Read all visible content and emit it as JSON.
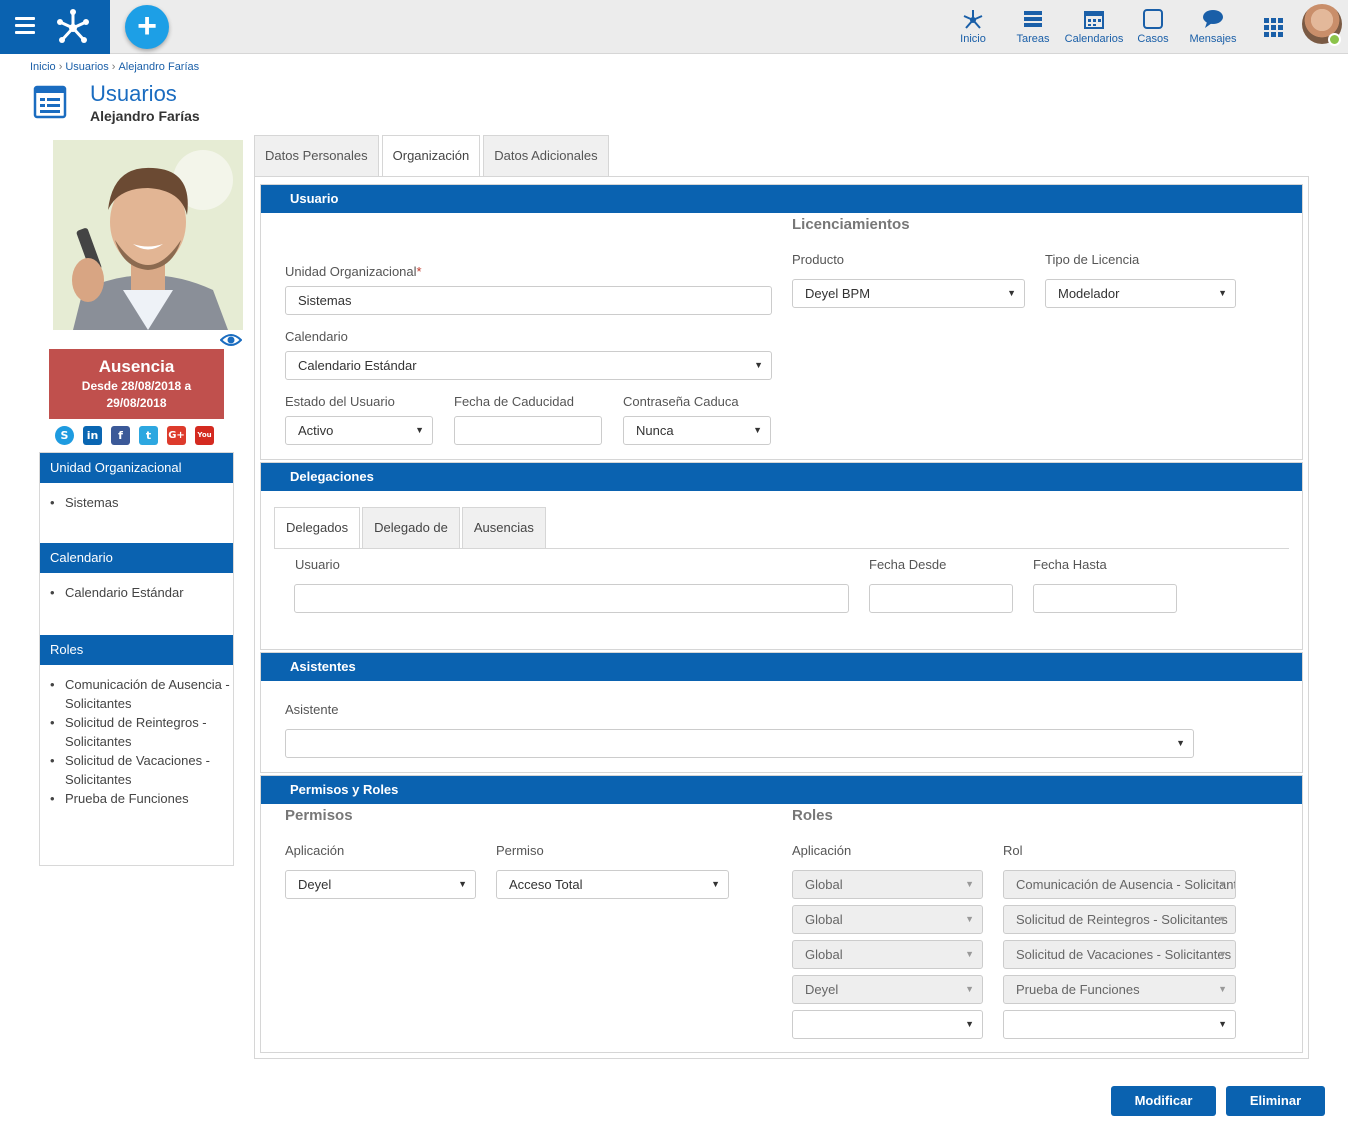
{
  "topbar": {
    "nav": [
      {
        "label": "Inicio",
        "icon": "network-icon"
      },
      {
        "label": "Tareas",
        "icon": "tasks-icon"
      },
      {
        "label": "Calendarios",
        "icon": "calendar-icon"
      },
      {
        "label": "Casos",
        "icon": "case-square-icon"
      },
      {
        "label": "Mensajes",
        "icon": "message-bubble-icon"
      }
    ],
    "brand_color": "#0a62b0",
    "add_color": "#1d9fe6"
  },
  "breadcrumb": [
    "Inicio",
    "Usuarios",
    "Alejandro Farías"
  ],
  "header": {
    "title": "Usuarios",
    "subtitle": "Alejandro Farías"
  },
  "profile": {
    "absence_title": "Ausencia",
    "absence_dates": "Desde 28/08/2018 a 29/08/2018",
    "absence_color": "#c0504d",
    "socials": [
      {
        "name": "skype-icon",
        "glyph": "S",
        "color": "#1e9be0"
      },
      {
        "name": "linkedin-icon",
        "glyph": "in",
        "color": "#0a66b2"
      },
      {
        "name": "facebook-icon",
        "glyph": "f",
        "color": "#3b5998"
      },
      {
        "name": "twitter-icon",
        "glyph": "t",
        "color": "#2da7e0"
      },
      {
        "name": "google-plus-icon",
        "glyph": "G+",
        "color": "#dd3b2c"
      },
      {
        "name": "youtube-icon",
        "glyph": "You",
        "color": "#d42a20"
      }
    ]
  },
  "sidebar": {
    "org_head": "Unidad Organizacional",
    "org_items": [
      "Sistemas"
    ],
    "cal_head": "Calendario",
    "cal_items": [
      "Calendario Estándar"
    ],
    "roles_head": "Roles",
    "roles_items": [
      "Comunicación de Ausencia - Solicitantes",
      "Solicitud de Reintegros - Solicitantes",
      "Solicitud de Vacaciones - Solicitantes",
      "Prueba de Funciones"
    ]
  },
  "tabs": [
    "Datos Personales",
    "Organización",
    "Datos Adicionales"
  ],
  "usuario": {
    "head": "Usuario",
    "org_label": "Unidad Organizacional",
    "org_required": "*",
    "org_value": "Sistemas",
    "cal_label": "Calendario",
    "cal_value": "Calendario Estándar",
    "estado_label": "Estado del Usuario",
    "estado_value": "Activo",
    "fecha_cad_label": "Fecha de Caducidad",
    "fecha_cad_value": "",
    "contr_label": "Contraseña Caduca",
    "contr_value": "Nunca",
    "lic_title": "Licenciamientos",
    "producto_label": "Producto",
    "producto_value": "Deyel BPM",
    "tipo_label": "Tipo de Licencia",
    "tipo_value": "Modelador"
  },
  "delegaciones": {
    "head": "Delegaciones",
    "subtabs": [
      "Delegados",
      "Delegado de",
      "Ausencias"
    ],
    "usuario_label": "Usuario",
    "desde_label": "Fecha Desde",
    "hasta_label": "Fecha Hasta"
  },
  "asistentes": {
    "head": "Asistentes",
    "asistente_label": "Asistente"
  },
  "permisos": {
    "head": "Permisos y Roles",
    "permisos_title": "Permisos",
    "aplicacion_label": "Aplicación",
    "permiso_label": "Permiso",
    "aplicacion_value": "Deyel",
    "permiso_value": "Acceso Total",
    "roles_title": "Roles",
    "roles_app_label": "Aplicación",
    "rol_label": "Rol",
    "rows": [
      {
        "app": "Global",
        "rol": "Comunicación de Ausencia - Solicitantes"
      },
      {
        "app": "Global",
        "rol": "Solicitud de Reintegros - Solicitantes"
      },
      {
        "app": "Global",
        "rol": "Solicitud de Vacaciones - Solicitantes"
      },
      {
        "app": "Deyel",
        "rol": "Prueba de Funciones"
      },
      {
        "app": "",
        "rol": ""
      }
    ]
  },
  "actions": {
    "modify": "Modificar",
    "delete": "Eliminar"
  }
}
